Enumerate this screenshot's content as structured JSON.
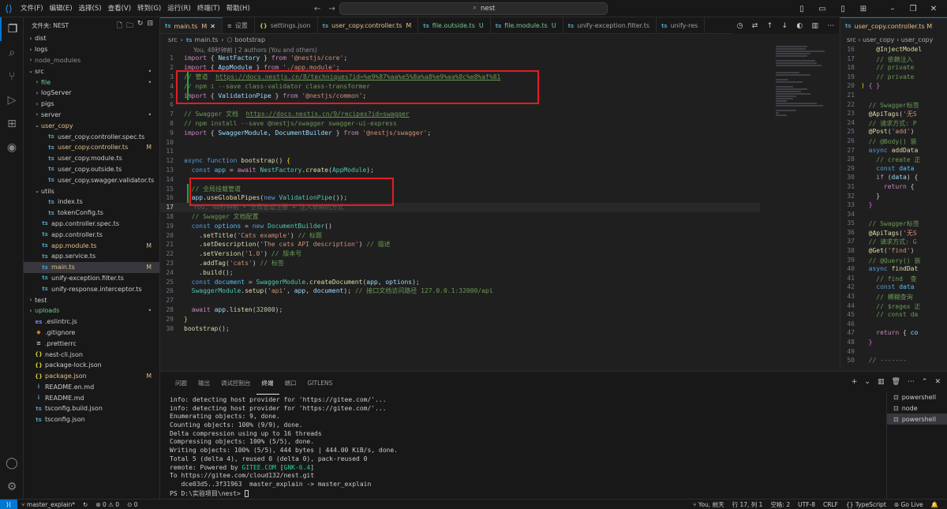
{
  "menu": [
    "文件(F)",
    "编辑(E)",
    "选择(S)",
    "查看(V)",
    "转到(G)",
    "运行(R)",
    "终端(T)",
    "帮助(H)"
  ],
  "search": {
    "text": "nest"
  },
  "sidebar": {
    "title": "文件夹: NEST",
    "items": [
      {
        "label": "dist",
        "indent": 0,
        "chev": "›",
        "icon": "",
        "color": "#cccccc",
        "badge": ""
      },
      {
        "label": "logs",
        "indent": 0,
        "chev": "›",
        "icon": "",
        "color": "#cccccc",
        "badge": ""
      },
      {
        "label": "node_modules",
        "indent": 0,
        "chev": "›",
        "icon": "",
        "color": "#8c8c8c",
        "badge": ""
      },
      {
        "label": "src",
        "indent": 0,
        "chev": "⌄",
        "icon": "",
        "color": "#cccccc",
        "badge": "•"
      },
      {
        "label": "file",
        "indent": 1,
        "chev": "›",
        "icon": "",
        "color": "#73c991",
        "badge": "•"
      },
      {
        "label": "logServer",
        "indent": 1,
        "chev": "›",
        "icon": "",
        "color": "#cccccc",
        "badge": ""
      },
      {
        "label": "pigs",
        "indent": 1,
        "chev": "›",
        "icon": "",
        "color": "#cccccc",
        "badge": ""
      },
      {
        "label": "server",
        "indent": 1,
        "chev": "›",
        "icon": "",
        "color": "#cccccc",
        "badge": "•"
      },
      {
        "label": "user_copy",
        "indent": 1,
        "chev": "⌄",
        "icon": "",
        "color": "#e2c08d",
        "badge": ""
      },
      {
        "label": "user_copy.controller.spec.ts",
        "indent": 2,
        "chev": "",
        "icon": "ts",
        "color": "#cccccc",
        "badge": ""
      },
      {
        "label": "user_copy.controller.ts",
        "indent": 2,
        "chev": "",
        "icon": "ts",
        "color": "#e2c08d",
        "badge": "M"
      },
      {
        "label": "user_copy.module.ts",
        "indent": 2,
        "chev": "",
        "icon": "ts",
        "color": "#cccccc",
        "badge": ""
      },
      {
        "label": "user_copy.outside.ts",
        "indent": 2,
        "chev": "",
        "icon": "ts",
        "color": "#cccccc",
        "badge": ""
      },
      {
        "label": "user_copy.swagger.validator.ts",
        "indent": 2,
        "chev": "",
        "icon": "ts",
        "color": "#cccccc",
        "badge": ""
      },
      {
        "label": "utils",
        "indent": 1,
        "chev": "⌄",
        "icon": "",
        "color": "#cccccc",
        "badge": ""
      },
      {
        "label": "index.ts",
        "indent": 2,
        "chev": "",
        "icon": "ts",
        "color": "#cccccc",
        "badge": ""
      },
      {
        "label": "tokenConfig.ts",
        "indent": 2,
        "chev": "",
        "icon": "ts",
        "color": "#cccccc",
        "badge": ""
      },
      {
        "label": "app.controller.spec.ts",
        "indent": 1,
        "chev": "",
        "icon": "ts",
        "color": "#cccccc",
        "badge": ""
      },
      {
        "label": "app.controller.ts",
        "indent": 1,
        "chev": "",
        "icon": "ts",
        "color": "#cccccc",
        "badge": ""
      },
      {
        "label": "app.module.ts",
        "indent": 1,
        "chev": "",
        "icon": "ts",
        "color": "#e2c08d",
        "badge": "M"
      },
      {
        "label": "app.service.ts",
        "indent": 1,
        "chev": "",
        "icon": "ts",
        "color": "#cccccc",
        "badge": ""
      },
      {
        "label": "main.ts",
        "indent": 1,
        "chev": "",
        "icon": "ts",
        "color": "#e2c08d",
        "badge": "M",
        "selected": true
      },
      {
        "label": "unify-exception.filter.ts",
        "indent": 1,
        "chev": "",
        "icon": "ts",
        "color": "#cccccc",
        "badge": ""
      },
      {
        "label": "unify-response.interceptor.ts",
        "indent": 1,
        "chev": "",
        "icon": "ts",
        "color": "#cccccc",
        "badge": ""
      },
      {
        "label": "test",
        "indent": 0,
        "chev": "›",
        "icon": "",
        "color": "#cccccc",
        "badge": ""
      },
      {
        "label": "uploads",
        "indent": 0,
        "chev": "›",
        "icon": "",
        "color": "#73c991",
        "badge": "•"
      },
      {
        "label": ".eslintrc.js",
        "indent": 0,
        "chev": "",
        "icon": "es",
        "color": "#cccccc",
        "badge": ""
      },
      {
        "label": ".gitignore",
        "indent": 0,
        "chev": "",
        "icon": "◆",
        "color": "#cccccc",
        "badge": ""
      },
      {
        "label": ".prettierrc",
        "indent": 0,
        "chev": "",
        "icon": "≡",
        "color": "#cccccc",
        "badge": ""
      },
      {
        "label": "nest-cli.json",
        "indent": 0,
        "chev": "",
        "icon": "{}",
        "color": "#cccccc",
        "badge": ""
      },
      {
        "label": "package-lock.json",
        "indent": 0,
        "chev": "",
        "icon": "{}",
        "color": "#cccccc",
        "badge": ""
      },
      {
        "label": "package.json",
        "indent": 0,
        "chev": "",
        "icon": "{}",
        "color": "#e2c08d",
        "badge": "M"
      },
      {
        "label": "README.en.md",
        "indent": 0,
        "chev": "",
        "icon": "i",
        "color": "#cccccc",
        "badge": ""
      },
      {
        "label": "README.md",
        "indent": 0,
        "chev": "",
        "icon": "i",
        "color": "#cccccc",
        "badge": ""
      },
      {
        "label": "tsconfig.build.json",
        "indent": 0,
        "chev": "",
        "icon": "ts",
        "color": "#cccccc",
        "badge": ""
      },
      {
        "label": "tsconfig.json",
        "indent": 0,
        "chev": "",
        "icon": "ts",
        "color": "#cccccc",
        "badge": ""
      }
    ]
  },
  "tabs": [
    {
      "label": "main.ts",
      "badge": "M",
      "icon": "ts",
      "active": true,
      "color": "#e2c08d"
    },
    {
      "label": "设置",
      "badge": "",
      "icon": "≡",
      "active": false,
      "color": "#9d9d9d"
    },
    {
      "label": "settings.json",
      "badge": "",
      "icon": "{}",
      "active": false,
      "color": "#9d9d9d"
    },
    {
      "label": "user_copy.controller.ts",
      "badge": "M",
      "icon": "ts",
      "active": false,
      "color": "#e2c08d"
    },
    {
      "label": "file.outside.ts",
      "badge": "U",
      "icon": "ts",
      "active": false,
      "color": "#73c991"
    },
    {
      "label": "file.module.ts",
      "badge": "U",
      "icon": "ts",
      "active": false,
      "color": "#73c991"
    },
    {
      "label": "unify-exception.filter.ts",
      "badge": "",
      "icon": "ts",
      "active": false,
      "color": "#9d9d9d"
    },
    {
      "label": "unify-res",
      "badge": "",
      "icon": "ts",
      "active": false,
      "color": "#9d9d9d"
    }
  ],
  "breadcrumb": [
    "src",
    "main.ts",
    "bootstrap"
  ],
  "codelens": "You, 48秒钟前 | 2 authors (You and others)",
  "code": [
    "<span class=\"kw2\">import</span> { <span class=\"vr\">NestFactory</span> } <span class=\"kw2\">from</span> <span class=\"str\">'@nestjs/core'</span>;",
    "<span class=\"kw2\">import</span> { <span class=\"vr\">AppModule</span> } <span class=\"kw2\">from</span> <span class=\"str\">'./app.module'</span>;",
    "<span class=\"cm\">// 管道  </span><span class=\"url\">https://docs.nestjs.cn/8/techniques?id=%e9%87%aa%e5%8a%a8%e9%aa%8c%e8%af%81</span>",
    "<span class=\"cm\">// npm i --save class-validator class-transformer</span>",
    "<span class=\"kw2\">import</span> { <span class=\"vr\">ValidationPipe</span> } <span class=\"kw2\">from</span> <span class=\"str\">'@nestjs/common'</span>;",
    "",
    "<span class=\"cm\">// Swagger 文档  </span><span class=\"url\">https://docs.nestjs.cn/9/recipes?id=swagger</span>",
    "<span class=\"cm\">// npm install --save @nestjs/swagger swagger-ui-express</span>",
    "<span class=\"kw2\">import</span> { <span class=\"vr\">SwaggerModule</span>, <span class=\"vr\">DocumentBuilder</span> } <span class=\"kw2\">from</span> <span class=\"str\">'@nestjs/swagger'</span>;",
    "",
    "",
    "<span class=\"kw\">async</span> <span class=\"kw\">function</span> <span class=\"fn\">bootstrap</span>() <span class=\"brk\">{</span>",
    "  <span class=\"kw\">const</span> <span class=\"const\">app</span> = <span class=\"kw2\">await</span> <span class=\"ty\">NestFactory</span>.<span class=\"fn\">create</span>(<span class=\"ty\">AppModule</span>);",
    "",
    "  <span class=\"cm\">// 全局挂载管道</span>",
    "  <span class=\"vr\">app</span>.<span class=\"fn\">useGlobalPipes</span>(<span class=\"kw\">new</span> <span class=\"ty\">ValidationPipe</span>());",
    "",
    "  <span class=\"cm\">// Swagger 文档配置</span>",
    "  <span class=\"kw\">const</span> <span class=\"const\">options</span> = <span class=\"kw\">new</span> <span class=\"ty\">DocumentBuilder</span>()",
    "    .<span class=\"fn\">setTitle</span>(<span class=\"str\">'Cats example'</span>) <span class=\"cm\">// 标题</span>",
    "    .<span class=\"fn\">setDescription</span>(<span class=\"str\">'The cats API description'</span>) <span class=\"cm\">// 描述</span>",
    "    .<span class=\"fn\">setVersion</span>(<span class=\"str\">'1.0'</span>) <span class=\"cm\">// 版本号</span>",
    "    .<span class=\"fn\">addTag</span>(<span class=\"str\">'cats'</span>) <span class=\"cm\">// 标签</span>",
    "    .<span class=\"fn\">build</span>();",
    "  <span class=\"kw\">const</span> <span class=\"const\">document</span> = <span class=\"ty\">SwaggerModule</span>.<span class=\"fn\">createDocument</span>(<span class=\"vr\">app</span>, <span class=\"vr\">options</span>);",
    "  <span class=\"ty\">SwaggerModule</span>.<span class=\"fn\">setup</span>(<span class=\"str\">'api'</span>, <span class=\"vr\">app</span>, <span class=\"vr\">document</span>); <span class=\"cm\">// 接口文档访问路径 127.0.0.1:32000/api</span>",
    "",
    "  <span class=\"kw2\">await</span> <span class=\"vr\">app</span>.<span class=\"fn\">listen</span>(<span class=\"nm\">32000</span>);",
    "<span class=\"brk\">}</span>",
    "<span class=\"fn\">bootstrap</span>();"
  ],
  "blame_line17": "You, 48秒钟前 • 全局管道注册 + 注入依赖的方式",
  "right_editor": {
    "tab": "user_copy.controller.ts M",
    "breadcrumb": "src › user_copy › user_copy",
    "lines": [
      {
        "n": "16",
        "t": "    <span class=\"fn\">@InjectModel</span>"
      },
      {
        "n": "17",
        "t": "    <span class=\"cm\">// 依赖注入</span>"
      },
      {
        "n": "18",
        "t": "    <span class=\"cm\">// private</span>"
      },
      {
        "n": "19",
        "t": "    <span class=\"cm\">// private</span>"
      },
      {
        "n": "20",
        "t": "<span class=\"brk\">)</span> <span class=\"brk2\">{ }</span>"
      },
      {
        "n": "21",
        "t": ""
      },
      {
        "n": "22",
        "t": "  <span class=\"cm\">// Swagger标签</span>"
      },
      {
        "n": "23",
        "t": "  <span class=\"fn\">@ApiTags</span>(<span class=\"str\">'无S</span>"
      },
      {
        "n": "24",
        "t": "  <span class=\"cm\">// 请求方式: P</span>"
      },
      {
        "n": "25",
        "t": "  <span class=\"fn\">@Post</span>(<span class=\"str\">'add'</span>)"
      },
      {
        "n": "26",
        "t": "  <span class=\"cm\">// @Body() 装</span>"
      },
      {
        "n": "27",
        "t": "  <span class=\"kw\">async</span> <span class=\"fn\">addData</span>"
      },
      {
        "n": "28",
        "t": "    <span class=\"cm\">// create 正</span>"
      },
      {
        "n": "29",
        "t": "    <span class=\"kw\">const</span> <span class=\"const\">data</span>"
      },
      {
        "n": "30",
        "t": "    <span class=\"kw2\">if</span> (<span class=\"vr\">data</span>) {"
      },
      {
        "n": "31",
        "t": "      <span class=\"kw2\">return</span> {"
      },
      {
        "n": "32",
        "t": "    }"
      },
      {
        "n": "33",
        "t": "  <span class=\"brk2\">}</span>"
      },
      {
        "n": "34",
        "t": ""
      },
      {
        "n": "35",
        "t": "  <span class=\"cm\">// Swagger标签</span>"
      },
      {
        "n": "36",
        "t": "  <span class=\"fn\">@ApiTags</span>(<span class=\"str\">'无S</span>"
      },
      {
        "n": "37",
        "t": "  <span class=\"cm\">// 请求方式: G</span>"
      },
      {
        "n": "38",
        "t": "  <span class=\"fn\">@Get</span>(<span class=\"str\">'find'</span>)"
      },
      {
        "n": "39",
        "t": "  <span class=\"cm\">// @Query() 装</span>"
      },
      {
        "n": "40",
        "t": "  <span class=\"kw\">async</span> <span class=\"fn\">findDat</span>"
      },
      {
        "n": "41",
        "t": "    <span class=\"cm\">// find  查</span>"
      },
      {
        "n": "42",
        "t": "    <span class=\"kw\">const</span> <span class=\"const\">data</span>"
      },
      {
        "n": "43",
        "t": "    <span class=\"cm\">// 模糊查询</span>"
      },
      {
        "n": "44",
        "t": "    <span class=\"cm\">// $regex 正</span>"
      },
      {
        "n": "45",
        "t": "    <span class=\"cm\">// const da</span>"
      },
      {
        "n": "46",
        "t": ""
      },
      {
        "n": "47",
        "t": "    <span class=\"kw2\">return</span> { <span class=\"vr\">co</span>"
      },
      {
        "n": "48",
        "t": "  <span class=\"brk2\">}</span>"
      },
      {
        "n": "49",
        "t": ""
      },
      {
        "n": "50",
        "t": "  <span class=\"cm\">// -------</span>"
      }
    ]
  },
  "panel": {
    "tabs": [
      "问题",
      "输出",
      "调试控制台",
      "终端",
      "端口",
      "GITLENS"
    ],
    "active_tab": 3,
    "terminal_lines": [
      "info: detecting host provider for 'https://gitee.com/'...",
      "info: detecting host provider for 'https://gitee.com/'...",
      "Enumerating objects: 9, done.",
      "Counting objects: 100% (9/9), done.",
      "Delta compression using up to 16 threads",
      "Compressing objects: 100% (5/5), done.",
      "Writing objects: 100% (5/5), 444 bytes | 444.00 KiB/s, done.",
      "Total 5 (delta 4), reused 0 (delta 0), pack-reused 0",
      "remote: Powered by <span class=\"green\">GITEE.COM</span> [<span class=\"green\">GNK-6.4</span>]",
      "To https://gitee.com/cloud132/nest.git",
      "   dce03d5..3f31963  master_explain -> master_explain",
      "PS D:\\实验项目\\nest> <span class=\"cursor\"></span>"
    ],
    "terminals": [
      {
        "label": "powershell",
        "active": false
      },
      {
        "label": "node",
        "active": false
      },
      {
        "label": "powershell",
        "active": true
      }
    ]
  },
  "status": {
    "branch": "master_explain*",
    "errors": "0",
    "warnings": "0",
    "ports": "0",
    "blame": "You, 前天",
    "position": "行 17, 列 1",
    "spaces": "空格: 2",
    "encoding": "UTF-8",
    "eol": "CRLF",
    "language": "TypeScript",
    "golive": "Go Live"
  }
}
